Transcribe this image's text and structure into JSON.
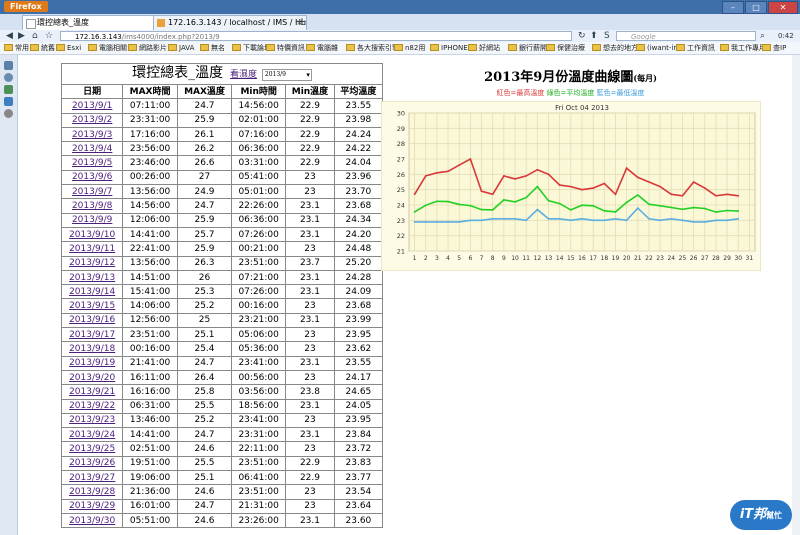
{
  "browser": {
    "app_button": "Firefox",
    "tabs": [
      {
        "label": "環控總表_溫度",
        "active": true
      },
      {
        "label": "172.16.3.143 / localhost / IMS / Hu...",
        "active": false
      }
    ],
    "url_host": "172.16.3.143",
    "url_path": "/ims4000/index.php?2013/9",
    "search_placeholder": "Google",
    "search_engine": "S",
    "clock": "0:42",
    "bookmarks": [
      "常用",
      "統舊",
      "Esxi",
      "電腦相關",
      "網路影片",
      "JAVA",
      "無名",
      "下載論壇",
      "特價資訊",
      "電腦雜",
      "各大搜索引擎",
      "n82用",
      "IPHONE",
      "好網站",
      "銀行薪開",
      "保健治療",
      "想去的地方",
      "(iwant-in)",
      "工作資訊",
      "我工作專用",
      "查IP"
    ]
  },
  "table": {
    "title": "環控總表_溫度",
    "link": "看濕度",
    "month_select": "2013/9",
    "headers": [
      "日期",
      "MAX時間",
      "MAX溫度",
      "Min時間",
      "Min溫度",
      "平均溫度"
    ],
    "rows": [
      [
        "2013/9/1",
        "07:11:00",
        "24.7",
        "14:56:00",
        "22.9",
        "23.55"
      ],
      [
        "2013/9/2",
        "23:31:00",
        "25.9",
        "02:01:00",
        "22.9",
        "23.98"
      ],
      [
        "2013/9/3",
        "17:16:00",
        "26.1",
        "07:16:00",
        "22.9",
        "24.24"
      ],
      [
        "2013/9/4",
        "23:56:00",
        "26.2",
        "06:36:00",
        "22.9",
        "24.22"
      ],
      [
        "2013/9/5",
        "23:46:00",
        "26.6",
        "03:31:00",
        "22.9",
        "24.04"
      ],
      [
        "2013/9/6",
        "00:26:00",
        "27",
        "05:41:00",
        "23",
        "23.96"
      ],
      [
        "2013/9/7",
        "13:56:00",
        "24.9",
        "05:01:00",
        "23",
        "23.70"
      ],
      [
        "2013/9/8",
        "14:56:00",
        "24.7",
        "22:26:00",
        "23.1",
        "23.68"
      ],
      [
        "2013/9/9",
        "12:06:00",
        "25.9",
        "06:36:00",
        "23.1",
        "24.34"
      ],
      [
        "2013/9/10",
        "14:41:00",
        "25.7",
        "07:26:00",
        "23.1",
        "24.20"
      ],
      [
        "2013/9/11",
        "22:41:00",
        "25.9",
        "00:21:00",
        "23",
        "24.48"
      ],
      [
        "2013/9/12",
        "13:56:00",
        "26.3",
        "23:51:00",
        "23.7",
        "25.20"
      ],
      [
        "2013/9/13",
        "14:51:00",
        "26",
        "07:21:00",
        "23.1",
        "24.28"
      ],
      [
        "2013/9/14",
        "15:41:00",
        "25.3",
        "07:26:00",
        "23.1",
        "24.09"
      ],
      [
        "2013/9/15",
        "14:06:00",
        "25.2",
        "00:16:00",
        "23",
        "23.68"
      ],
      [
        "2013/9/16",
        "12:56:00",
        "25",
        "23:21:00",
        "23.1",
        "23.99"
      ],
      [
        "2013/9/17",
        "23:51:00",
        "25.1",
        "05:06:00",
        "23",
        "23.95"
      ],
      [
        "2013/9/18",
        "00:16:00",
        "25.4",
        "05:36:00",
        "23",
        "23.62"
      ],
      [
        "2013/9/19",
        "21:41:00",
        "24.7",
        "23:41:00",
        "23.1",
        "23.55"
      ],
      [
        "2013/9/20",
        "16:11:00",
        "26.4",
        "00:56:00",
        "23",
        "24.17"
      ],
      [
        "2013/9/21",
        "16:16:00",
        "25.8",
        "03:56:00",
        "23.8",
        "24.65"
      ],
      [
        "2013/9/22",
        "06:31:00",
        "25.5",
        "18:56:00",
        "23.1",
        "24.05"
      ],
      [
        "2013/9/23",
        "13:46:00",
        "25.2",
        "23:41:00",
        "23",
        "23.95"
      ],
      [
        "2013/9/24",
        "14:41:00",
        "24.7",
        "23:31:00",
        "23.1",
        "23.84"
      ],
      [
        "2013/9/25",
        "02:51:00",
        "24.6",
        "22:11:00",
        "23",
        "23.72"
      ],
      [
        "2013/9/26",
        "19:51:00",
        "25.5",
        "23:51:00",
        "22.9",
        "23.83"
      ],
      [
        "2013/9/27",
        "19:06:00",
        "25.1",
        "06:41:00",
        "22.9",
        "23.77"
      ],
      [
        "2013/9/28",
        "21:36:00",
        "24.6",
        "23:51:00",
        "23",
        "23.54"
      ],
      [
        "2013/9/29",
        "16:01:00",
        "24.7",
        "21:31:00",
        "23",
        "23.64"
      ],
      [
        "2013/9/30",
        "05:51:00",
        "24.6",
        "23:26:00",
        "23.1",
        "23.60"
      ]
    ]
  },
  "chart_header": {
    "title_main": "2013年9月份溫度曲線圖",
    "title_suffix": "(每月)",
    "legend_red": "紅色=最高溫度",
    "legend_green": "綠色=平均溫度",
    "legend_blue": "藍色=最低溫度"
  },
  "chart_data": {
    "type": "line",
    "title": "Fri Oct 04 2013",
    "x": [
      1,
      2,
      3,
      4,
      5,
      6,
      7,
      8,
      9,
      10,
      11,
      12,
      13,
      14,
      15,
      16,
      17,
      18,
      19,
      20,
      21,
      22,
      23,
      24,
      25,
      26,
      27,
      28,
      29,
      30
    ],
    "x_ticks": [
      1,
      2,
      3,
      4,
      5,
      6,
      7,
      8,
      9,
      10,
      11,
      12,
      13,
      14,
      15,
      16,
      17,
      18,
      19,
      20,
      21,
      22,
      23,
      24,
      25,
      26,
      27,
      28,
      29,
      30,
      31
    ],
    "xlim": [
      0.5,
      31.5
    ],
    "ylim": [
      21,
      30
    ],
    "y_ticks": [
      21,
      22,
      23,
      24,
      25,
      26,
      27,
      28,
      29,
      30
    ],
    "grid": true,
    "colors": {
      "max": "#d9383a",
      "avg": "#22d022",
      "min": "#5aaee0",
      "plot_bg": "#fbf8d8",
      "grid": "#e2ddb4"
    },
    "series": [
      {
        "key": "max",
        "values": [
          24.7,
          25.9,
          26.1,
          26.2,
          26.6,
          27,
          24.9,
          24.7,
          25.9,
          25.7,
          25.9,
          26.3,
          26,
          25.3,
          25.2,
          25,
          25.1,
          25.4,
          24.7,
          26.4,
          25.8,
          25.5,
          25.2,
          24.7,
          24.6,
          25.5,
          25.1,
          24.6,
          24.7,
          24.6
        ]
      },
      {
        "key": "avg",
        "values": [
          23.55,
          23.98,
          24.24,
          24.22,
          24.04,
          23.96,
          23.7,
          23.68,
          24.34,
          24.2,
          24.48,
          25.2,
          24.28,
          24.09,
          23.68,
          23.99,
          23.95,
          23.62,
          23.55,
          24.17,
          24.65,
          24.05,
          23.95,
          23.84,
          23.72,
          23.83,
          23.77,
          23.54,
          23.64,
          23.6
        ]
      },
      {
        "key": "min",
        "values": [
          22.9,
          22.9,
          22.9,
          22.9,
          22.9,
          23,
          23,
          23.1,
          23.1,
          23.1,
          23,
          23.7,
          23.1,
          23.1,
          23,
          23.1,
          23,
          23,
          23.1,
          23,
          23.8,
          23.1,
          23,
          23.1,
          23,
          22.9,
          22.9,
          23,
          23,
          23.1
        ]
      }
    ]
  },
  "watermark": {
    "main": "iT邦",
    "sub": "幫忙"
  }
}
